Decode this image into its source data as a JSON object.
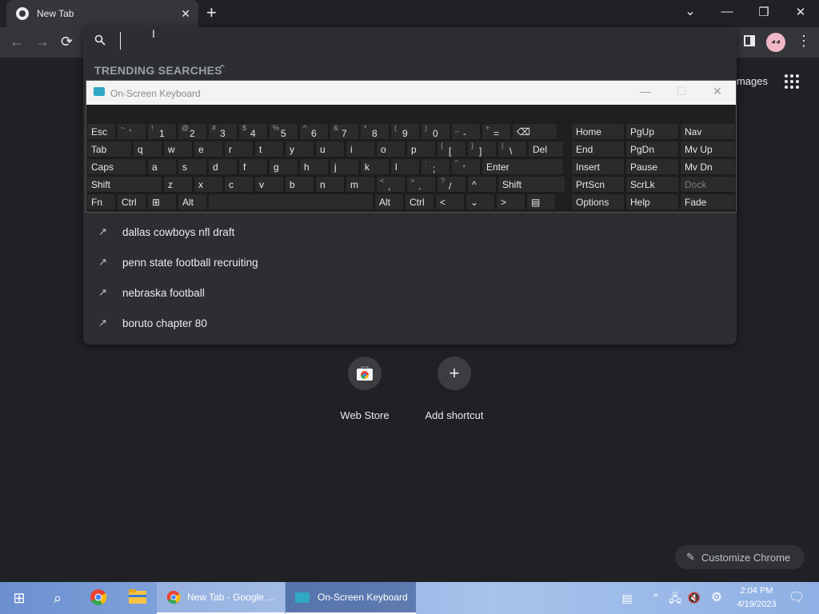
{
  "browser": {
    "tab_title": "New Tab",
    "tab_close": "✕",
    "new_tab": "+",
    "window_controls": {
      "dropdown": "⌄",
      "minimize": "—",
      "restore": "❐",
      "close": "✕"
    }
  },
  "toolbar": {
    "back": "←",
    "forward": "→",
    "reload": "⟳",
    "images_label": "Images",
    "menu": "⋮"
  },
  "omnibox": {
    "search_icon": "search-icon",
    "value": "",
    "trending_header": "TRENDING SEARCHES",
    "trending_toggle": "⌃",
    "trending": [
      {
        "icon": "↗",
        "text": "dallas cowboys nfl draft"
      },
      {
        "icon": "↗",
        "text": "penn state football recruiting"
      },
      {
        "icon": "↗",
        "text": "nebraska football"
      },
      {
        "icon": "↗",
        "text": "boruto chapter 80"
      }
    ]
  },
  "osk": {
    "title": "On-Screen Keyboard",
    "minimize": "—",
    "maximize": "☐",
    "close": "✕",
    "row1": [
      {
        "m": "Esc"
      },
      {
        "s": "~",
        "p": "`"
      },
      {
        "s": "!",
        "p": "1"
      },
      {
        "s": "@",
        "p": "2"
      },
      {
        "s": "#",
        "p": "3"
      },
      {
        "s": "$",
        "p": "4"
      },
      {
        "s": "%",
        "p": "5"
      },
      {
        "s": "^",
        "p": "6"
      },
      {
        "s": "&",
        "p": "7"
      },
      {
        "s": "*",
        "p": "8"
      },
      {
        "s": "(",
        "p": "9"
      },
      {
        "s": ")",
        "p": "0"
      },
      {
        "s": "_",
        "p": "-"
      },
      {
        "s": "+",
        "p": "="
      },
      {
        "m": "⌫"
      }
    ],
    "row2": [
      {
        "m": "Tab"
      },
      {
        "m": "q"
      },
      {
        "m": "w"
      },
      {
        "m": "e"
      },
      {
        "m": "r"
      },
      {
        "m": "t"
      },
      {
        "m": "y"
      },
      {
        "m": "u"
      },
      {
        "m": "i"
      },
      {
        "m": "o"
      },
      {
        "m": "p"
      },
      {
        "s": "{",
        "p": "["
      },
      {
        "s": "}",
        "p": "]"
      },
      {
        "s": "|",
        "p": "\\"
      },
      {
        "m": "Del"
      }
    ],
    "row3": [
      {
        "m": "Caps"
      },
      {
        "m": "a"
      },
      {
        "m": "s"
      },
      {
        "m": "d"
      },
      {
        "m": "f"
      },
      {
        "m": "g"
      },
      {
        "m": "h"
      },
      {
        "m": "j"
      },
      {
        "m": "k"
      },
      {
        "m": "l"
      },
      {
        "s": ":",
        "p": ";"
      },
      {
        "s": "\"",
        "p": "'"
      },
      {
        "m": "Enter"
      }
    ],
    "row4": [
      {
        "m": "Shift"
      },
      {
        "m": "z"
      },
      {
        "m": "x"
      },
      {
        "m": "c"
      },
      {
        "m": "v"
      },
      {
        "m": "b"
      },
      {
        "m": "n"
      },
      {
        "m": "m"
      },
      {
        "s": "<",
        "p": ","
      },
      {
        "s": ">",
        "p": "."
      },
      {
        "s": "?",
        "p": "/"
      },
      {
        "m": "^"
      },
      {
        "m": "Shift"
      }
    ],
    "row5": [
      {
        "m": "Fn"
      },
      {
        "m": "Ctrl"
      },
      {
        "m": "⊞"
      },
      {
        "m": "Alt"
      },
      {
        "m": ""
      },
      {
        "m": "Alt"
      },
      {
        "m": "Ctrl"
      },
      {
        "m": "<"
      },
      {
        "m": "⌄"
      },
      {
        "m": ">"
      },
      {
        "m": "▤"
      }
    ],
    "nav": [
      [
        "Home",
        "PgUp",
        "Nav"
      ],
      [
        "End",
        "PgDn",
        "Mv Up"
      ],
      [
        "Insert",
        "Pause",
        "Mv Dn"
      ],
      [
        "PrtScn",
        "ScrLk",
        "Dock"
      ],
      [
        "Options",
        "Help",
        "Fade"
      ]
    ]
  },
  "shortcuts": [
    {
      "label": "Web Store",
      "icon": "web-store-icon"
    },
    {
      "label": "Add shortcut",
      "icon": "plus-icon",
      "glyph": "+"
    }
  ],
  "customize_label": "Customize Chrome",
  "taskbar": {
    "start": "⊞",
    "search": "⌕",
    "chrome_window": "New Tab - Google ...",
    "osk_window": "On-Screen Keyboard",
    "time": "2:04 PM",
    "date": "4/19/2023"
  }
}
